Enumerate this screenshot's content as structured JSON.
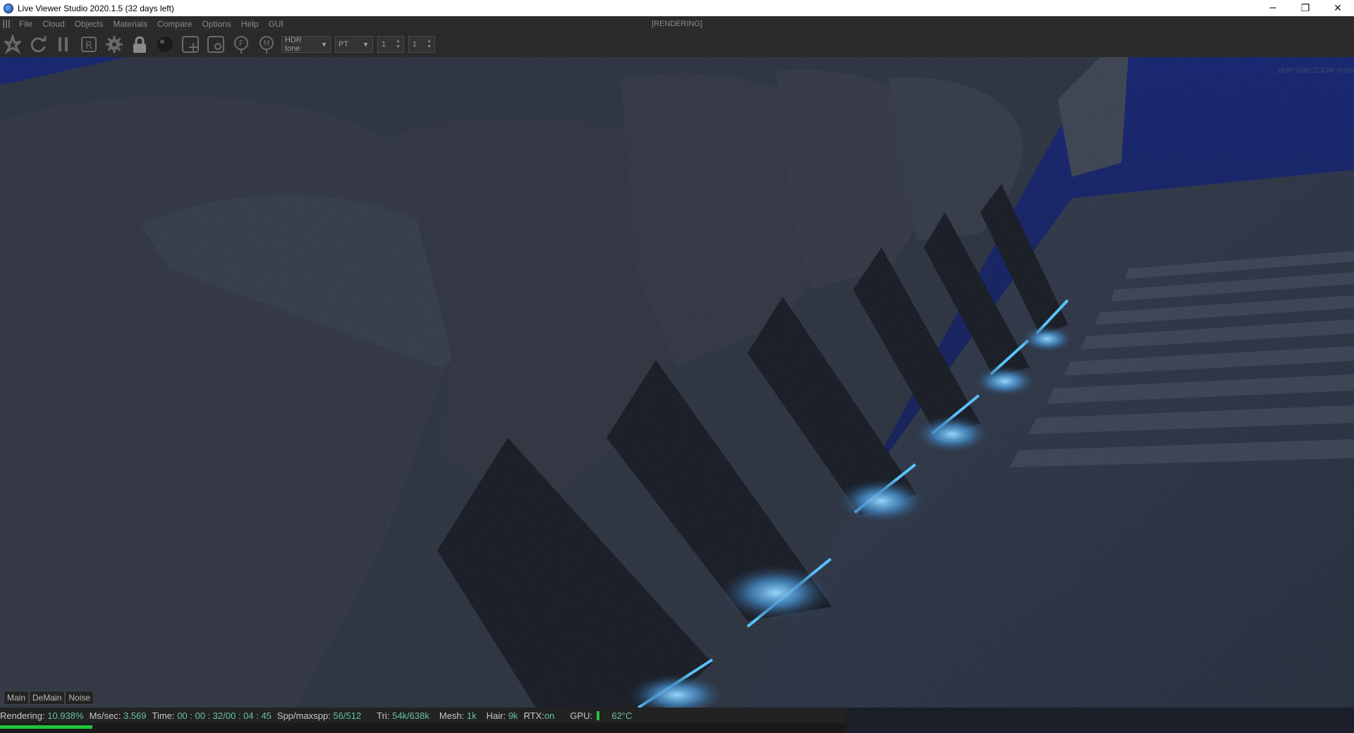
{
  "window": {
    "title": "Live Viewer Studio 2020.1.5 (32 days left)",
    "minimize_glyph": "─",
    "maximize_glyph": "❐",
    "close_glyph": "✕"
  },
  "menu": {
    "items": [
      "File",
      "Cloud",
      "Objects",
      "Materials",
      "Compare",
      "Options",
      "Help",
      "GUI"
    ],
    "status": "[RENDERING]"
  },
  "toolbar": {
    "icons": [
      "aperture-icon",
      "refresh-icon",
      "pause-icon",
      "region-render-icon",
      "settings-gear-icon",
      "lock-icon",
      "material-ball-icon",
      "add-object-icon",
      "focus-picker-icon",
      "f-pick-icon",
      "m-pick-icon"
    ],
    "tone_select": "HDR tone",
    "kernel_select": "PT",
    "spin1": "1",
    "spin2": "1"
  },
  "viewport": {
    "resolution_label": "1920*1080 ZOOM:%100"
  },
  "tabs": [
    "Main",
    "DeMain",
    "Noise"
  ],
  "status": {
    "rendering_label": "Rendering:",
    "rendering_value": "10.938%",
    "mssec_label": "Ms/sec:",
    "mssec_value": "3.569",
    "time_label": "Time:",
    "time_value": "00 : 00 : 32/00 : 04 : 45",
    "spp_label": "Spp/maxspp:",
    "spp_value": "56/512",
    "tri_label": "Tri:",
    "tri_value": "54k/638k",
    "mesh_label": "Mesh:",
    "mesh_value": "1k",
    "hair_label": "Hair:",
    "hair_value": "9k",
    "rtx_label": "RTX:",
    "rtx_value": "on",
    "gpu_label": "GPU:",
    "gpu_temp": "62°C",
    "progress_fraction": 0.10938
  },
  "colors": {
    "accent_green": "#22c33a",
    "value_teal": "#66c0a0",
    "glow_blue": "#4fc3ff"
  }
}
